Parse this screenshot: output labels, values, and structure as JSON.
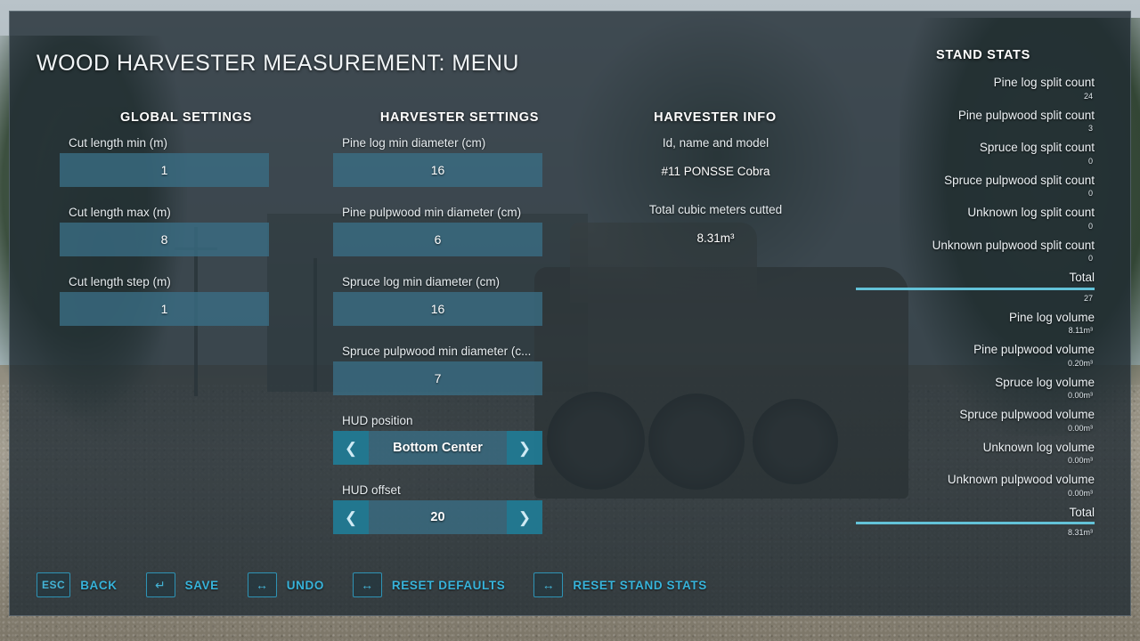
{
  "title": "WOOD HARVESTER MEASUREMENT: MENU",
  "columns": {
    "global": {
      "header": "GLOBAL SETTINGS",
      "fields": [
        {
          "label": "Cut length min (m)",
          "value": "1"
        },
        {
          "label": "Cut length max (m)",
          "value": "8"
        },
        {
          "label": "Cut length step (m)",
          "value": "1"
        }
      ]
    },
    "harvester": {
      "header": "HARVESTER SETTINGS",
      "fields": [
        {
          "label": "Pine log min diameter (cm)",
          "value": "16"
        },
        {
          "label": "Pine pulpwood min diameter (cm)",
          "value": "6"
        },
        {
          "label": "Spruce log min diameter (cm)",
          "value": "16"
        },
        {
          "label": "Spruce pulpwood min diameter (c...",
          "value": "7"
        }
      ],
      "steppers": [
        {
          "label": "HUD position",
          "value": "Bottom Center",
          "prev_icon": "chevron-left-icon",
          "next_icon": "chevron-right-icon"
        },
        {
          "label": "HUD offset",
          "value": "20",
          "prev_icon": "chevron-left-icon",
          "next_icon": "chevron-right-icon"
        }
      ]
    },
    "info": {
      "header": "HARVESTER INFO",
      "rows": [
        {
          "label": "Id, name and model",
          "value": "#11 PONSSE Cobra"
        },
        {
          "label": "Total cubic meters cutted",
          "value": "8.31m³"
        }
      ]
    },
    "stats": {
      "header": "STAND STATS",
      "items": [
        {
          "label": "Pine log split count",
          "value": "24"
        },
        {
          "label": "Pine pulpwood split count",
          "value": "3"
        },
        {
          "label": "Spruce log split count",
          "value": "0"
        },
        {
          "label": "Spruce pulpwood split count",
          "value": "0"
        },
        {
          "label": "Unknown log split count",
          "value": "0"
        },
        {
          "label": "Unknown pulpwood split count",
          "value": "0"
        },
        {
          "label": "Total",
          "value": "27",
          "divider": true
        },
        {
          "label": "Pine log volume",
          "value": "8.11m³"
        },
        {
          "label": "Pine pulpwood volume",
          "value": "0.20m³"
        },
        {
          "label": "Spruce log volume",
          "value": "0.00m³"
        },
        {
          "label": "Spruce pulpwood volume",
          "value": "0.00m³"
        },
        {
          "label": "Unknown log volume",
          "value": "0.00m³"
        },
        {
          "label": "Unknown pulpwood volume",
          "value": "0.00m³"
        },
        {
          "label": "Total",
          "value": "8.31m³",
          "divider": true
        }
      ]
    }
  },
  "actions": [
    {
      "key": "ESC",
      "key_icon": "esc-key",
      "label": "BACK"
    },
    {
      "key": "↵",
      "key_icon": "enter-key",
      "label": "SAVE"
    },
    {
      "key": "↔",
      "key_icon": "left-right-key",
      "label": "UNDO"
    },
    {
      "key": "↔",
      "key_icon": "left-right-key",
      "label": "RESET DEFAULTS"
    },
    {
      "key": "↔",
      "key_icon": "left-right-key",
      "label": "RESET STAND STATS"
    }
  ],
  "colors": {
    "panel_bg": "#202c33",
    "field_fill": "#3a6e85",
    "arrow_fill": "#217c96",
    "accent": "#37b3da",
    "divider": "#63c2d8",
    "text": "#edf2f5"
  }
}
